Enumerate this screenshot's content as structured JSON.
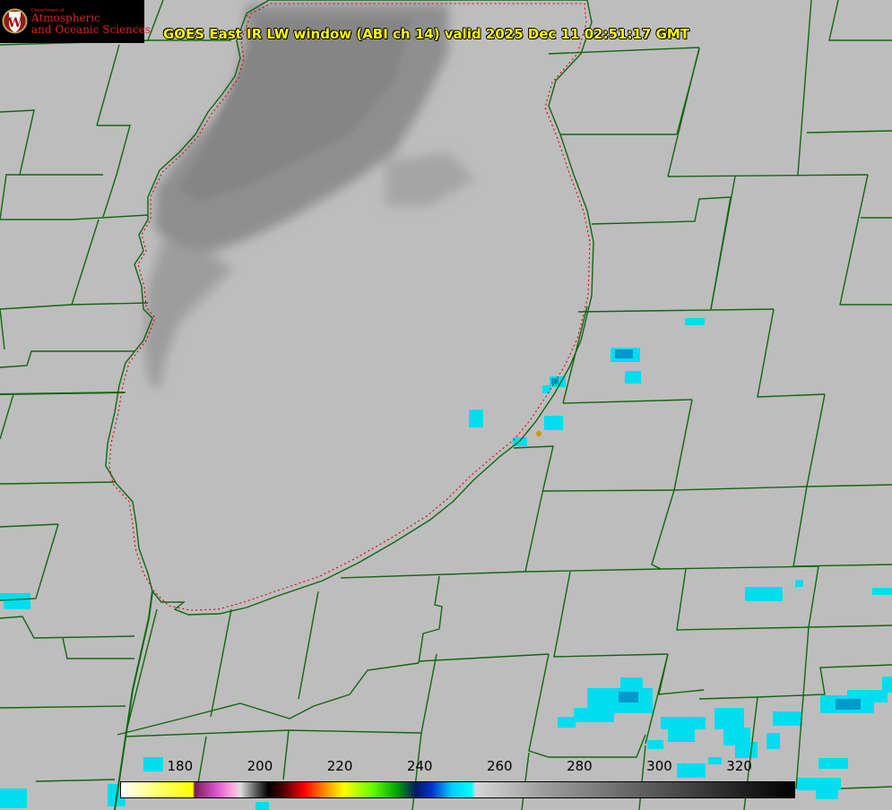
{
  "title": "GOES East IR LW window (ABI ch 14) valid 2025 Dec 11 02:51:17 GMT",
  "logo": {
    "department": "Department of",
    "line1": "Atmospheric",
    "line2": "and Oceanic Sciences",
    "seal_letter": "W",
    "icon": "uw-crest-icon"
  },
  "colorbar": {
    "ticks": [
      "180",
      "200",
      "220",
      "240",
      "260",
      "280",
      "300",
      "320"
    ],
    "range": [
      165,
      334
    ],
    "stops": [
      {
        "v": 165,
        "c": "#ffffff"
      },
      {
        "v": 175,
        "c": "#ffff66"
      },
      {
        "v": 183,
        "c": "#ffff00"
      },
      {
        "v": 183.5,
        "c": "#7a1a5a"
      },
      {
        "v": 189,
        "c": "#dd55cc"
      },
      {
        "v": 193,
        "c": "#ffaadd"
      },
      {
        "v": 195,
        "c": "#dddddd"
      },
      {
        "v": 199,
        "c": "#555555"
      },
      {
        "v": 202,
        "c": "#000000"
      },
      {
        "v": 206,
        "c": "#550000"
      },
      {
        "v": 211,
        "c": "#ff0000"
      },
      {
        "v": 216,
        "c": "#ff8800"
      },
      {
        "v": 221,
        "c": "#ffff00"
      },
      {
        "v": 228,
        "c": "#66ff00"
      },
      {
        "v": 234,
        "c": "#00aa00"
      },
      {
        "v": 239,
        "c": "#001a66"
      },
      {
        "v": 243,
        "c": "#0033cc"
      },
      {
        "v": 248,
        "c": "#00ccff"
      },
      {
        "v": 253,
        "c": "#00ffff"
      },
      {
        "v": 254,
        "c": "#d6d6d6"
      },
      {
        "v": 270,
        "c": "#a0a0a0"
      },
      {
        "v": 300,
        "c": "#555555"
      },
      {
        "v": 334,
        "c": "#000000"
      }
    ]
  },
  "colors": {
    "background": "#bdbdbd",
    "boundary": "#116611",
    "lake_shoreline": "#dd0000",
    "title_text": "#ffff00",
    "cold_cloud": "#00ddee",
    "station_marker": "#cc9900"
  },
  "map_layers": [
    "county-boundaries",
    "state-boundaries",
    "lake-michigan-shoreline"
  ]
}
